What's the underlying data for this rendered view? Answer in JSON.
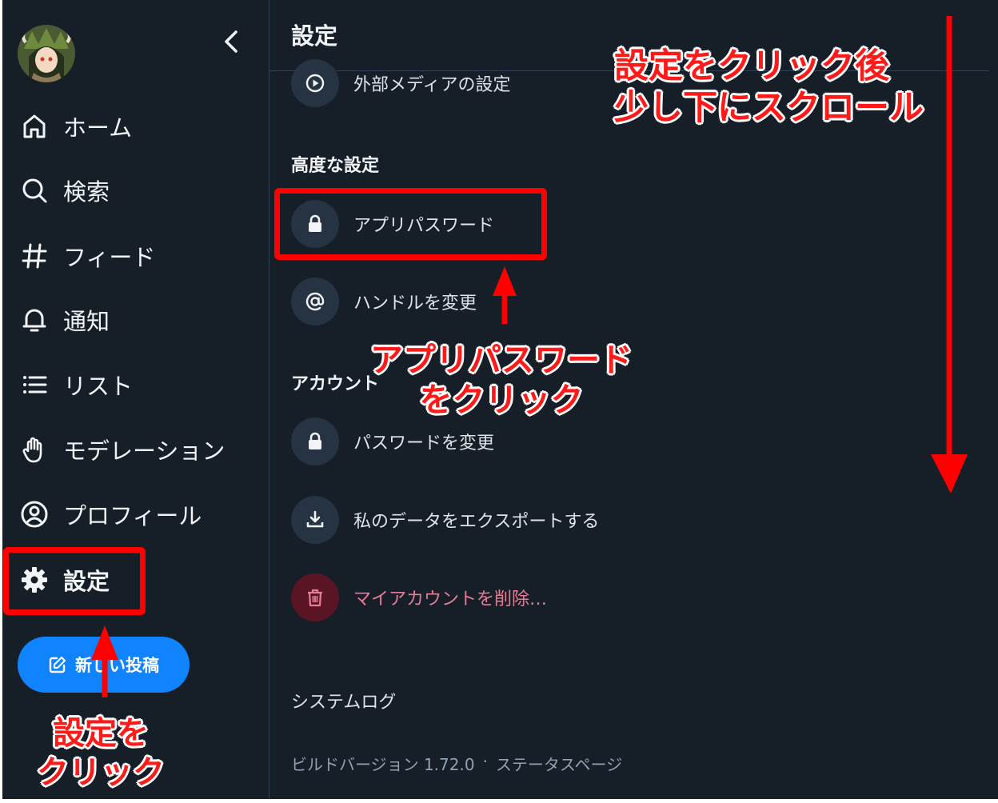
{
  "sidebar": {
    "avatar_name": "avatar",
    "back_icon": "chevron-left-icon",
    "items": [
      {
        "label": "ホーム",
        "icon": "home-icon"
      },
      {
        "label": "検索",
        "icon": "search-icon"
      },
      {
        "label": "フィード",
        "icon": "hash-icon"
      },
      {
        "label": "通知",
        "icon": "bell-icon"
      },
      {
        "label": "リスト",
        "icon": "list-icon"
      },
      {
        "label": "モデレーション",
        "icon": "hand-icon"
      },
      {
        "label": "プロフィール",
        "icon": "user-circle-icon"
      },
      {
        "label": "設定",
        "icon": "gear-icon",
        "active": true
      }
    ],
    "compose_label": "新しい投稿"
  },
  "main": {
    "title": "設定",
    "external_media": "外部メディアの設定",
    "advanced_title": "高度な設定",
    "app_password": "アプリパスワード",
    "change_handle": "ハンドルを変更",
    "account_title": "アカウント",
    "change_password": "パスワードを変更",
    "export_data": "私のデータをエクスポートする",
    "delete_account": "マイアカウントを削除…",
    "system_log": "システムログ",
    "build_version": "ビルドバージョン 1.72.0",
    "separator": "·",
    "status_page": "ステータスページ"
  },
  "annotations": {
    "scroll_note": [
      "設定をクリック後",
      "少し下にスクロール"
    ],
    "app_password_note": [
      "アプリパスワード",
      "をクリック"
    ],
    "settings_note": [
      "設定を",
      "クリック"
    ]
  },
  "colors": {
    "background": "#161e27",
    "accent": "#1083fe",
    "danger_text": "#e77d95",
    "annotation_red": "#ff0000"
  }
}
